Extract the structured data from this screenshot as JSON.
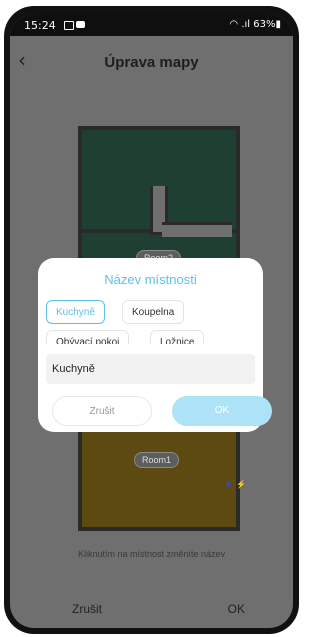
{
  "status": {
    "time": "15:24",
    "right": "63%"
  },
  "appbar": {
    "back_icon": "back-arrow-icon",
    "title": "Úprava mapy"
  },
  "map": {
    "rooms": [
      {
        "name": "Room2"
      },
      {
        "name": "Room1"
      }
    ],
    "hint": "Kliknutím na místnost změníte název"
  },
  "bottom": {
    "cancel": "Zrušit",
    "ok": "OK"
  },
  "dialog": {
    "title": "Název místnosti",
    "chips": [
      "Kuchyně",
      "Koupelna",
      "Obývací pokoj",
      "Ložnice"
    ],
    "selected_chip": "Kuchyně",
    "input_value": "Kuchyně",
    "cancel": "Zrušit",
    "ok": "OK",
    "accent_color": "#5ec0e6"
  }
}
